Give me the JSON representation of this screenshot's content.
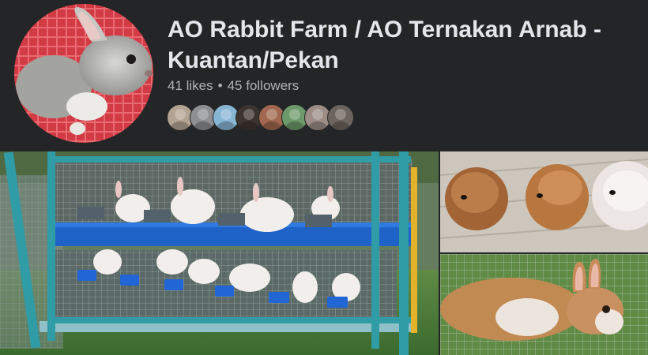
{
  "page": {
    "name": "AO Rabbit Farm / AO Ternakan Arnab - Kuantan/Pekan",
    "likes": "41 likes",
    "separator": "•",
    "followers": "45 followers"
  },
  "followers_preview": [
    {
      "color": "#b3a392"
    },
    {
      "color": "#8e8f93"
    },
    {
      "color": "#87b5d4"
    },
    {
      "color": "#3b3431"
    },
    {
      "color": "#a1684f"
    },
    {
      "color": "#6d9a6b"
    },
    {
      "color": "#9c8d86"
    },
    {
      "color": "#6b655d"
    }
  ],
  "colors": {
    "background": "#242526",
    "title": "#e4e6eb",
    "subtext": "#b0b3b8",
    "cage_frame": "#2f9ca6",
    "cage_blue": "#1f63c9",
    "grass": "#4d7d3a"
  },
  "icons": {
    "profile": "rabbit-photo",
    "cover": "rabbit-cage-photo"
  }
}
